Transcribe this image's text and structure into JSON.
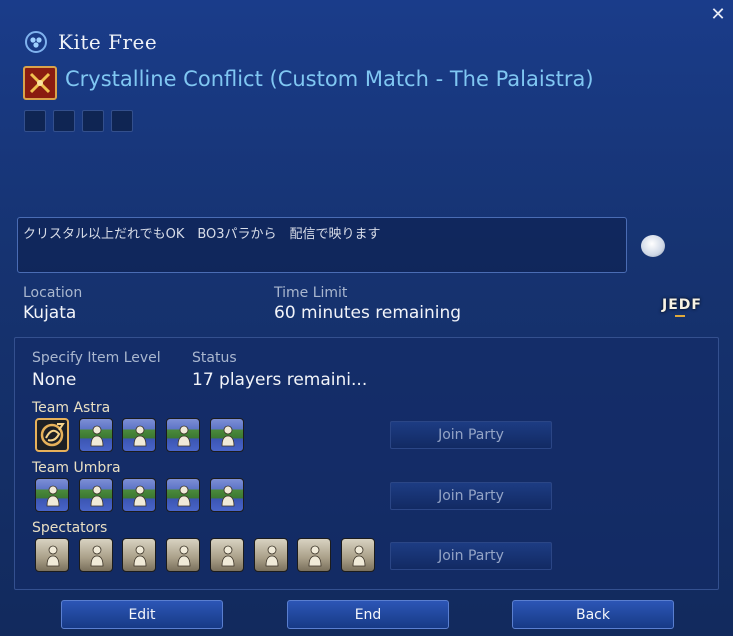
{
  "header": {
    "owner_name": "Kite Free",
    "duty_title": "Crystalline Conflict (Custom Match - The Palaistra)",
    "close_glyph": "✕"
  },
  "comment": {
    "text": "クリスタル以上だれでもOK　BO3パラから　配信で映ります"
  },
  "info": {
    "location_label": "Location",
    "location_value": "Kujata",
    "time_label": "Time Limit",
    "time_value": "60 minutes remaining",
    "badge": "JEDF"
  },
  "details": {
    "item_level_label": "Specify Item Level",
    "item_level_value": "None",
    "status_label": "Status",
    "status_value": "17 players remaini..."
  },
  "teams": [
    {
      "label": "Team Astra",
      "slots": [
        "leader",
        "filled",
        "filled",
        "filled",
        "filled"
      ],
      "join_label": "Join Party"
    },
    {
      "label": "Team Umbra",
      "slots": [
        "filled",
        "filled",
        "filled",
        "filled",
        "filled"
      ],
      "join_label": "Join Party"
    },
    {
      "label": "Spectators",
      "slots": [
        "empty",
        "empty",
        "empty",
        "empty",
        "empty",
        "empty",
        "empty",
        "empty"
      ],
      "join_label": "Join Party"
    }
  ],
  "footer": {
    "edit_label": "Edit",
    "end_label": "End",
    "back_label": "Back"
  },
  "colors": {
    "background": "#163371",
    "title_blue": "#80c7f2",
    "team_label": "#e9dfc3",
    "accent_gold": "#e0a93b"
  },
  "icons": {
    "header": "party-finder-icon",
    "duty": "crossed-swords-icon",
    "chat": "speech-bubble-icon",
    "close": "close-icon",
    "slot": "player-figure-icon"
  }
}
